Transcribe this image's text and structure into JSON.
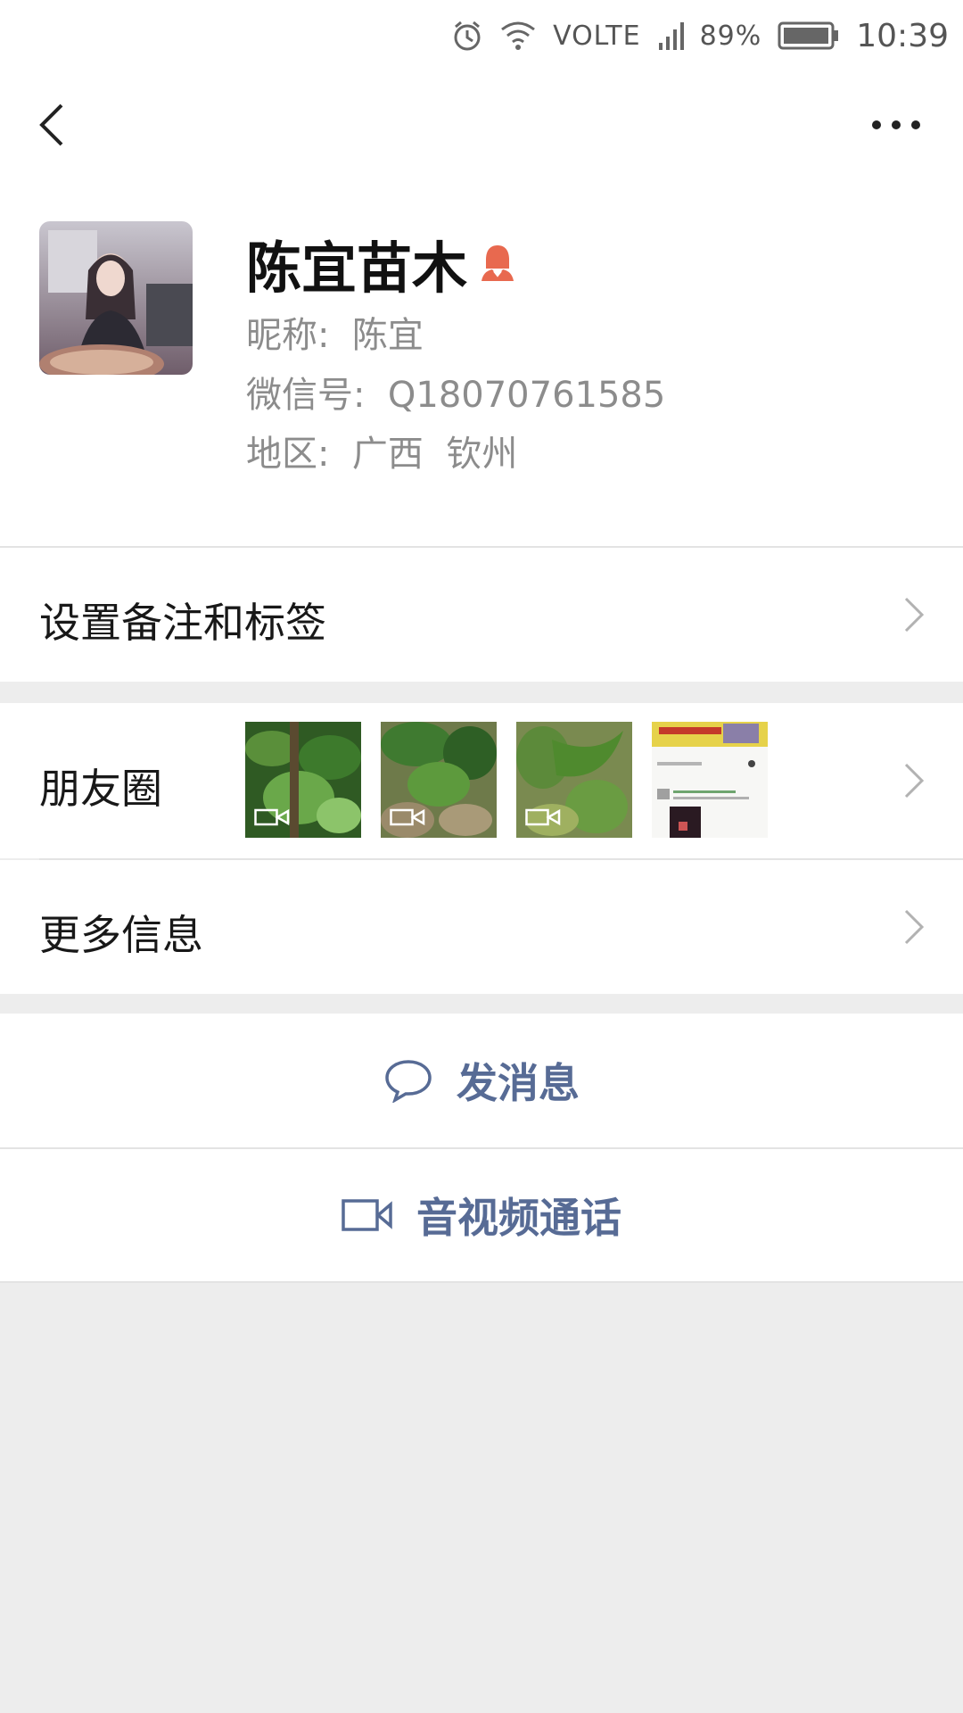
{
  "status_bar": {
    "network": "VOLTE",
    "battery": "89%",
    "time": "10:39",
    "icons": [
      "alarm-icon",
      "wifi-icon",
      "signal-icon",
      "battery-icon"
    ]
  },
  "header": {
    "back_icon": "back-chevron-icon",
    "more_icon": "more-dots-icon"
  },
  "profile": {
    "name": "陈宜苗木",
    "gender_icon": "female-icon",
    "nickname": "昵称:  陈宜",
    "wechat_id": "微信号:  Q18070761585",
    "region": "地区:  广西  钦州"
  },
  "rows": {
    "remark": "设置备注和标签",
    "moments": "朋友圈",
    "more_info": "更多信息"
  },
  "actions": {
    "message": "发消息",
    "message_icon": "chat-bubble-icon",
    "call": "音视频通话",
    "call_icon": "video-camera-icon"
  },
  "colors": {
    "accent": "#576b95",
    "female": "#e8694f",
    "background": "#ededed"
  }
}
